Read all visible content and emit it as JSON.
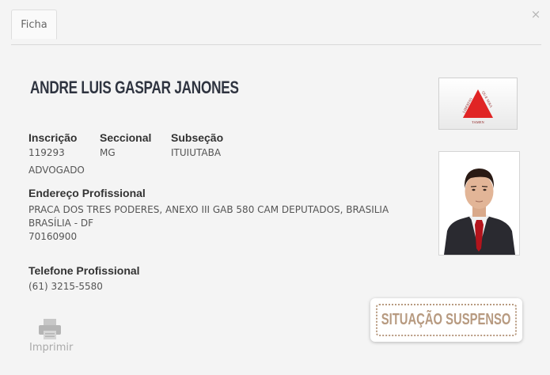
{
  "tabs": [
    {
      "label": "Ficha"
    }
  ],
  "close_symbol": "×",
  "person": {
    "name": "ANDRE LUIS GASPAR JANONES",
    "fields": {
      "inscricao_label": "Inscrição",
      "inscricao_value": "119293",
      "seccional_label": "Seccional",
      "seccional_value": "MG",
      "subsecao_label": "Subseção",
      "subsecao_value": "ITUIUTABA"
    },
    "type": "ADVOGADO",
    "endereco": {
      "label": "Endereço Profissional",
      "line1": "PRACA DOS TRES PODERES, ANEXO III GAB 580 CAM DEPUTADOS, BRASILIA",
      "line2": "BRASÍLIA - DF",
      "line3": "70160900"
    },
    "telefone": {
      "label": "Telefone Profissional",
      "value": "(61)  3215-5580"
    }
  },
  "flag": {
    "motto_left": "LIBERTAS",
    "motto_right": "QUÆ SERA",
    "motto_bottom": "TAMEN",
    "triangle_color": "#e02424"
  },
  "actions": {
    "print_label": "Imprimir"
  },
  "status": {
    "text": "SITUAÇÃO SUSPENSO"
  },
  "icons": {
    "close": "close-icon",
    "print": "printer-icon"
  },
  "colors": {
    "name": "#2f3440",
    "status": "#b79a80"
  }
}
